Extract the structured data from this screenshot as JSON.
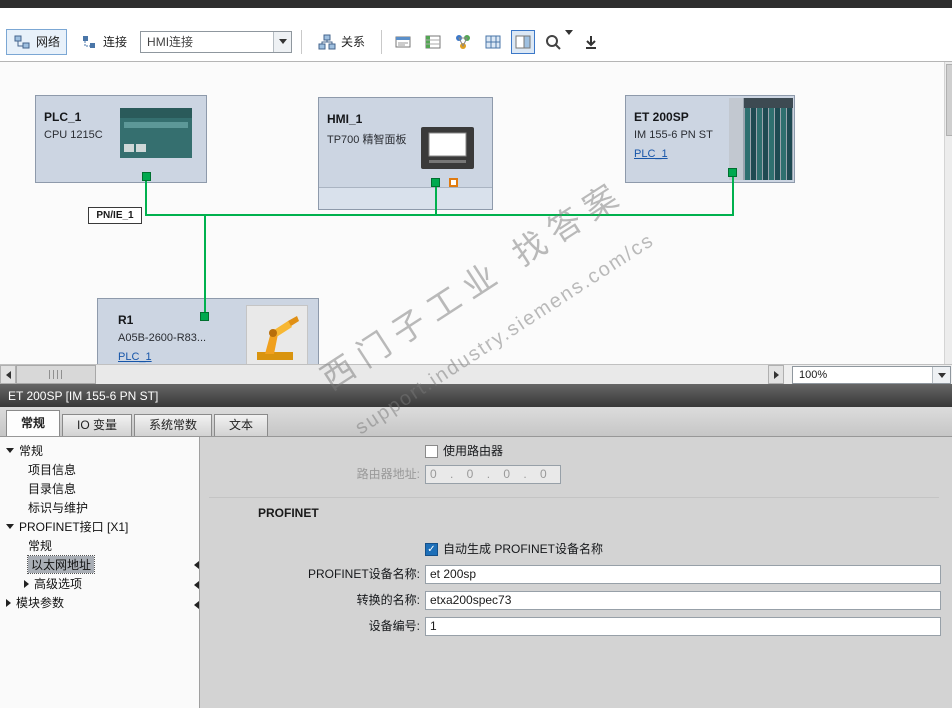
{
  "toolbar": {
    "network": "网络",
    "connections": "连接",
    "connection_filter": "HMI连接",
    "relations": "关系"
  },
  "statusbar": {
    "zoom": "100%"
  },
  "canvas": {
    "net_label": "PN/IE_1",
    "watermark": {
      "line1": "西门子工业  找答案",
      "line2": "support.industry.siemens.com/cs"
    },
    "devices": {
      "plc": {
        "name": "PLC_1",
        "model": "CPU 1215C"
      },
      "hmi": {
        "name": "HMI_1",
        "model": "TP700 精智面板"
      },
      "et200sp": {
        "name": "ET 200SP",
        "model": "IM 155-6 PN ST",
        "link": "PLC_1"
      },
      "robot": {
        "name": "R1",
        "model": "A05B-2600-R83...",
        "link": "PLC_1"
      }
    }
  },
  "inspector": {
    "title": "ET 200SP [IM 155-6 PN ST]",
    "tabs": {
      "general": "常规",
      "io_tags": "IO 变量",
      "system_constants": "系统常数",
      "texts": "文本"
    },
    "nav": {
      "general": "常规",
      "project_info": "项目信息",
      "catalog_info": "目录信息",
      "ident_maint": "标识与维护",
      "profinet_interface": "PROFINET接口 [X1]",
      "if_general": "常规",
      "ethernet_addresses": "以太网地址",
      "advanced_options": "高级选项",
      "module_parameters": "模块参数"
    },
    "form": {
      "use_router": "使用路由器",
      "router_address_label": "路由器地址:",
      "router_address_value": "0    .    0    .    0    .    0",
      "profinet_section": "PROFINET",
      "auto_generate": "自动生成 PROFINET设备名称",
      "device_name_label": "PROFINET设备名称:",
      "device_name_value": "et 200sp",
      "converted_name_label": "转换的名称:",
      "converted_name_value": "etxa200spec73",
      "device_number_label": "设备编号:",
      "device_number_value": "1"
    }
  }
}
